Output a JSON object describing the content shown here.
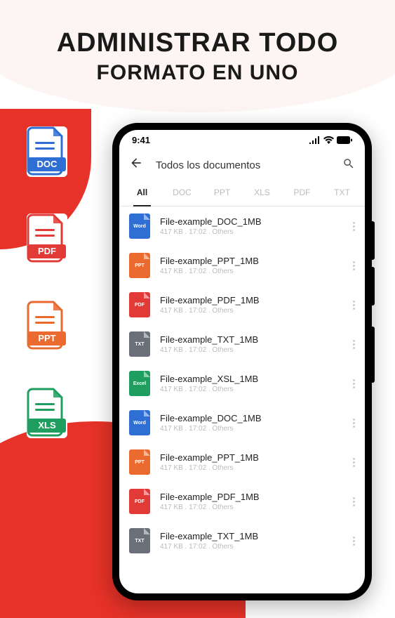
{
  "headline": {
    "line1": "ADMINISTRAR TODO",
    "line2": "FORMATO EN UNO"
  },
  "sideIcons": [
    {
      "label": "DOC",
      "color": "#2f6fd4"
    },
    {
      "label": "PDF",
      "color": "#e23a36"
    },
    {
      "label": "PPT",
      "color": "#ea6a2f"
    },
    {
      "label": "XLS",
      "color": "#1f9e5f"
    }
  ],
  "statusBar": {
    "time": "9:41"
  },
  "header": {
    "title": "Todos los documentos"
  },
  "tabs": [
    {
      "label": "All",
      "active": true
    },
    {
      "label": "DOC",
      "active": false
    },
    {
      "label": "PPT",
      "active": false
    },
    {
      "label": "XLS",
      "active": false
    },
    {
      "label": "PDF",
      "active": false
    },
    {
      "label": "TXT",
      "active": false
    }
  ],
  "files": [
    {
      "name": "File-example_DOC_1MB",
      "meta": "417 KB . 17:02 . Others",
      "type": "Word",
      "cls": "ft-word"
    },
    {
      "name": "File-example_PPT_1MB",
      "meta": "417 KB . 17:02 . Others",
      "type": "PPT",
      "cls": "ft-ppt"
    },
    {
      "name": "File-example_PDF_1MB",
      "meta": "417 KB . 17:02 . Others",
      "type": "PDF",
      "cls": "ft-pdf"
    },
    {
      "name": "File-example_TXT_1MB",
      "meta": "417 KB . 17:02 . Others",
      "type": "TXT",
      "cls": "ft-txt"
    },
    {
      "name": "File-example_XSL_1MB",
      "meta": "417 KB . 17:02 . Others",
      "type": "Excel",
      "cls": "ft-excel"
    },
    {
      "name": "File-example_DOC_1MB",
      "meta": "417 KB . 17:02 . Others",
      "type": "Word",
      "cls": "ft-word"
    },
    {
      "name": "File-example_PPT_1MB",
      "meta": "417 KB . 17:02 . Others",
      "type": "PPT",
      "cls": "ft-ppt"
    },
    {
      "name": "File-example_PDF_1MB",
      "meta": "417 KB . 17:02 . Others",
      "type": "PDF",
      "cls": "ft-pdf"
    },
    {
      "name": "File-example_TXT_1MB",
      "meta": "417 KB . 17:02 . Others",
      "type": "TXT",
      "cls": "ft-txt"
    }
  ]
}
